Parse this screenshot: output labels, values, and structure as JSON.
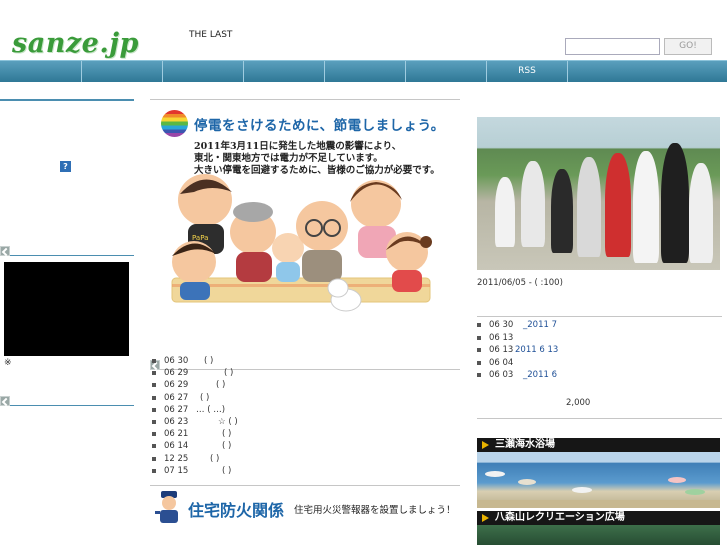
{
  "header": {
    "logo": "sanze.jp",
    "tagline": "THE LAST",
    "search_placeholder": "",
    "go_label": "GO!"
  },
  "nav": {
    "items": [
      "",
      "",
      "",
      "",
      "",
      "",
      "RSS",
      ""
    ]
  },
  "banner": {
    "title": "停電をさけるために、節電しましょう。",
    "lines": [
      "2011年3月11日に発生した地震の影響により、",
      "東北・関東地方では電力が不足しています。",
      "大きい停電を回避するために、皆様のご協力が必要です。"
    ],
    "shirt_text": "PaPa"
  },
  "sidebar": {
    "help_label": "?",
    "video_note": "※"
  },
  "news": [
    {
      "date": "06 30",
      "title": "(        )"
    },
    {
      "date": "06 29",
      "title": "(        )"
    },
    {
      "date": "06 29",
      "title": "(        )"
    },
    {
      "date": "06 27",
      "title": "(        )"
    },
    {
      "date": "06 27",
      "title": "… (      …)"
    },
    {
      "date": "06 23",
      "title": "☆ (        )"
    },
    {
      "date": "06 21",
      "title": "(        )"
    },
    {
      "date": "06 14",
      "title": "(        )"
    },
    {
      "date": "12 25",
      "title": "(        )"
    },
    {
      "date": "07 15",
      "title": "(        )"
    }
  ],
  "fire_banner": {
    "title": "住宅防火関係",
    "subtitle": "住宅用火災警報器を設置しましょう！"
  },
  "photo": {
    "caption": "2011/06/05    - (    :100)"
  },
  "right_list": [
    {
      "date": "06 30",
      "link": "_2011 7"
    },
    {
      "date": "06 13",
      "link": ""
    },
    {
      "date": "06 13",
      "link": "2011 6 13"
    },
    {
      "date": "06 04",
      "link": ""
    },
    {
      "date": "06 03",
      "link": "_2011 6"
    }
  ],
  "count": "2,000",
  "banners": [
    "三瀬海水浴場",
    "八森山レクリエーション広場"
  ]
}
